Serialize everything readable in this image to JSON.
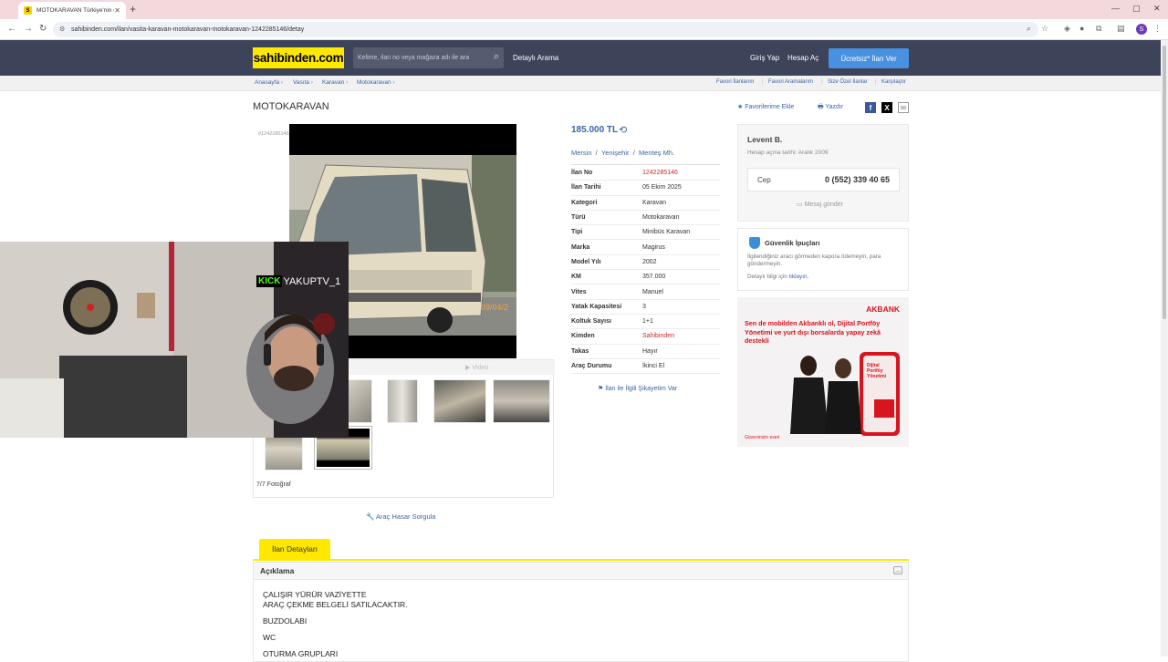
{
  "browser": {
    "tab_title": "MOTOKARAVAN Türkiye'nin en",
    "favicon_letter": "S",
    "url": "sahibinden.com/ilan/vasita-karavan-motokaravan-motokaravan-1242285146/detay",
    "profile_initial": "S"
  },
  "header": {
    "logo": "sahibinden.com",
    "search_placeholder": "Kelime, ilan no veya mağaza adı ile ara",
    "detailed_search": "Detaylı Arama",
    "login": "Giriş Yap",
    "register": "Hesap Aç",
    "post_ad": "Ücretsiz* İlan Ver"
  },
  "breadcrumb": [
    "Anasayfa",
    "Vasıta",
    "Karavan",
    "Motokaravan"
  ],
  "top_links": [
    "Favori İlanlarım",
    "Favori Aramalarım",
    "Size Özel İlanlar",
    "Karşılaştır"
  ],
  "listing": {
    "title": "MOTOKARAVAN",
    "add_favorite": "Favorilerime Ekle",
    "print": "Yazdır",
    "ad_number_overlay": "#1242285146",
    "image_date": "09/04/2",
    "gallery_tab_photo": "raf",
    "gallery_tab_video": "Video",
    "photo_count": "7/7 Fotoğraf",
    "damage_query": "Araç Hasar Sorgula"
  },
  "info": {
    "price": "185.000 TL",
    "location": [
      "Mersin",
      "Yenişehir",
      "Menteş Mh."
    ],
    "rows": [
      {
        "key": "İlan No",
        "value": "1242285146",
        "red": true
      },
      {
        "key": "İlan Tarihi",
        "value": "05 Ekim 2025"
      },
      {
        "key": "Kategori",
        "value": "Karavan"
      },
      {
        "key": "Türü",
        "value": "Motokaravan"
      },
      {
        "key": "Tipi",
        "value": "Minibüs Karavan"
      },
      {
        "key": "Marka",
        "value": "Magirus"
      },
      {
        "key": "Model Yılı",
        "value": "2002"
      },
      {
        "key": "KM",
        "value": "357.000"
      },
      {
        "key": "Vites",
        "value": "Manuel"
      },
      {
        "key": "Yatak Kapasitesi",
        "value": "3"
      },
      {
        "key": "Koltuk Sayısı",
        "value": "1+1"
      },
      {
        "key": "Kimden",
        "value": "Sahibinden",
        "red": true
      },
      {
        "key": "Takas",
        "value": "Hayır"
      },
      {
        "key": "Araç Durumu",
        "value": "İkinci El"
      }
    ],
    "complaint": "İlan ile İlgili Şikayetim Var"
  },
  "seller": {
    "name": "Levent B.",
    "since": "Hesap açma tarihi: Aralık 2009",
    "phone_label": "Cep",
    "phone": "0 (552) 339 40 65",
    "message": "Mesaj gönder"
  },
  "safety": {
    "title": "Güvenlik İpuçları",
    "body": "İlgilendiğiniz aracı görmeden kapora ödemeyin, para göndermeyin.",
    "more_prefix": "Detaylı bilgi için",
    "more_link": "tıklayın."
  },
  "ad": {
    "brand": "AKBANK",
    "text": "Sen de mobilden Akbanklı ol, Dijital Portföy Yönetimi ve yurt dışı borsalarda yapay zekâ destekli",
    "phone_screen": "Dijital Portföy Yönetimi",
    "footer": "Güveninizin eseri"
  },
  "details": {
    "tab": "İlan Detayları",
    "section": "Açıklama",
    "lines": [
      "ÇALIŞIR YÜRÜR VAZİYETTE",
      "ARAÇ ÇEKME BELGELİ SATILACAKTIR.",
      "BUZDOLABI",
      "WC",
      "OTURMA GRUPLARI"
    ]
  },
  "overlay": {
    "kick_logo": "KICK",
    "channel": "YAKUPTV_1"
  }
}
